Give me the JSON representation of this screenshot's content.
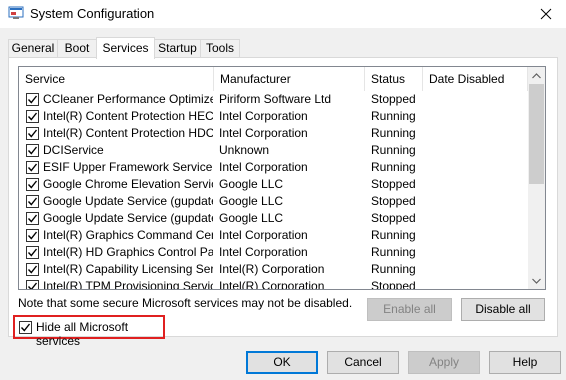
{
  "window": {
    "title": "System Configuration"
  },
  "tabs": [
    {
      "label": "General"
    },
    {
      "label": "Boot"
    },
    {
      "label": "Services"
    },
    {
      "label": "Startup"
    },
    {
      "label": "Tools"
    }
  ],
  "active_tab": "Services",
  "table": {
    "headers": {
      "service": "Service",
      "manufacturer": "Manufacturer",
      "status": "Status",
      "date_disabled": "Date Disabled"
    },
    "rows": [
      {
        "checked": true,
        "service": "CCleaner Performance Optimizer...",
        "manufacturer": "Piriform Software Ltd",
        "status": "Stopped",
        "date_disabled": ""
      },
      {
        "checked": true,
        "service": "Intel(R) Content Protection HEC...",
        "manufacturer": "Intel Corporation",
        "status": "Running",
        "date_disabled": ""
      },
      {
        "checked": true,
        "service": "Intel(R) Content Protection HDC...",
        "manufacturer": "Intel Corporation",
        "status": "Running",
        "date_disabled": ""
      },
      {
        "checked": true,
        "service": "DCIService",
        "manufacturer": "Unknown",
        "status": "Running",
        "date_disabled": ""
      },
      {
        "checked": true,
        "service": "ESIF Upper Framework Service",
        "manufacturer": "Intel Corporation",
        "status": "Running",
        "date_disabled": ""
      },
      {
        "checked": true,
        "service": "Google Chrome Elevation Servic...",
        "manufacturer": "Google LLC",
        "status": "Stopped",
        "date_disabled": ""
      },
      {
        "checked": true,
        "service": "Google Update Service (gupdate)",
        "manufacturer": "Google LLC",
        "status": "Stopped",
        "date_disabled": ""
      },
      {
        "checked": true,
        "service": "Google Update Service (gupdatem)",
        "manufacturer": "Google LLC",
        "status": "Stopped",
        "date_disabled": ""
      },
      {
        "checked": true,
        "service": "Intel(R) Graphics Command Cen...",
        "manufacturer": "Intel Corporation",
        "status": "Running",
        "date_disabled": ""
      },
      {
        "checked": true,
        "service": "Intel(R) HD Graphics Control Pa...",
        "manufacturer": "Intel Corporation",
        "status": "Running",
        "date_disabled": ""
      },
      {
        "checked": true,
        "service": "Intel(R) Capability Licensing Ser...",
        "manufacturer": "Intel(R) Corporation",
        "status": "Running",
        "date_disabled": ""
      },
      {
        "checked": true,
        "service": "Intel(R) TPM Provisioning Service",
        "manufacturer": "Intel(R) Corporation",
        "status": "Stopped",
        "date_disabled": ""
      }
    ]
  },
  "note": "Note that some secure Microsoft services may not be disabled.",
  "buttons": {
    "enable_all": "Enable all",
    "disable_all": "Disable all",
    "ok": "OK",
    "cancel": "Cancel",
    "apply": "Apply",
    "help": "Help"
  },
  "hide_ms": {
    "label": "Hide all Microsoft services",
    "checked": true
  },
  "colors": {
    "highlight_border": "#e02020",
    "default_button_border": "#0078d7"
  },
  "icons": {
    "app": "system-configuration-icon",
    "close": "close-icon"
  }
}
